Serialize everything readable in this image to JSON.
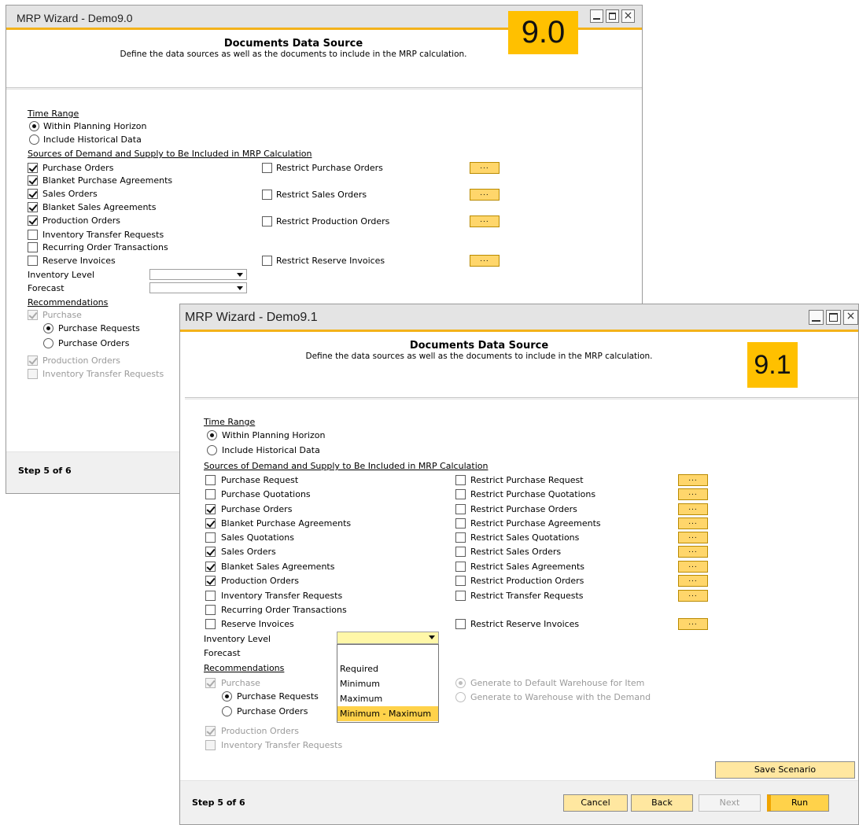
{
  "win90": {
    "title": "MRP Wizard - Demo9.0",
    "version": "9.0",
    "header_title": "Documents Data Source",
    "header_sub": "Define the data sources as well as the documents to include in the MRP calculation.",
    "time_range_label": "Time Range",
    "radio_within": "Within Planning Horizon",
    "radio_hist": "Include Historical Data",
    "sources_label": "Sources of Demand and Supply to Be Included in MRP Calculation",
    "sources": [
      {
        "label": "Purchase Orders",
        "checked": true
      },
      {
        "label": "Blanket Purchase Agreements",
        "checked": true
      },
      {
        "label": "Sales Orders",
        "checked": true
      },
      {
        "label": "Blanket Sales Agreements",
        "checked": true
      },
      {
        "label": "Production Orders",
        "checked": true
      },
      {
        "label": "Inventory Transfer Requests",
        "checked": false
      },
      {
        "label": "Recurring Order Transactions",
        "checked": false
      },
      {
        "label": "Reserve Invoices",
        "checked": false
      }
    ],
    "restricts": [
      "Restrict Purchase Orders",
      "Restrict Sales Orders",
      "Restrict Production Orders",
      "Restrict Reserve Invoices"
    ],
    "ellipsis": "...",
    "inventory_level": "Inventory Level",
    "forecast": "Forecast",
    "recommendations": "Recommendations",
    "purchase": "Purchase",
    "purchase_requests": "Purchase Requests",
    "purchase_orders": "Purchase Orders",
    "production_orders": "Production Orders",
    "inventory_transfer_requests": "Inventory Transfer Requests",
    "step": "Step 5 of 6"
  },
  "win91": {
    "title": "MRP Wizard - Demo9.1",
    "version": "9.1",
    "header_title": "Documents Data Source",
    "header_sub": "Define the data sources as well as the documents to include in the MRP calculation.",
    "time_range_label": "Time Range",
    "radio_within": "Within Planning Horizon",
    "radio_hist": "Include Historical Data",
    "sources_label": "Sources of Demand and Supply to Be Included in MRP Calculation",
    "sources": [
      {
        "label": "Purchase Request",
        "checked": false
      },
      {
        "label": "Purchase Quotations",
        "checked": false
      },
      {
        "label": "Purchase Orders",
        "checked": true
      },
      {
        "label": "Blanket Purchase Agreements",
        "checked": true
      },
      {
        "label": "Sales Quotations",
        "checked": false
      },
      {
        "label": "Sales Orders",
        "checked": true
      },
      {
        "label": "Blanket Sales Agreements",
        "checked": true
      },
      {
        "label": "Production Orders",
        "checked": true
      },
      {
        "label": "Inventory Transfer Requests",
        "checked": false
      },
      {
        "label": "Recurring Order Transactions",
        "checked": false
      },
      {
        "label": "Reserve Invoices",
        "checked": false
      }
    ],
    "restricts": [
      "Restrict Purchase Request",
      "Restrict Purchase Quotations",
      "Restrict Purchase Orders",
      "Restrict Purchase Agreements",
      "Restrict Sales Quotations",
      "Restrict Sales Orders",
      "Restrict Sales Agreements",
      "Restrict Production Orders",
      "Restrict Transfer Requests",
      "Restrict Reserve Invoices"
    ],
    "ellipsis": "...",
    "inventory_level": "Inventory Level",
    "forecast": "Forecast",
    "dropdown_options": [
      "Required",
      "Minimum",
      "Maximum",
      "Minimum - Maximum"
    ],
    "dropdown_selected": "Minimum - Maximum",
    "recommendations": "Recommendations",
    "purchase": "Purchase",
    "purchase_requests": "Purchase Requests",
    "purchase_orders": "Purchase Orders",
    "gen_default": "Generate to Default Warehouse for Item",
    "gen_demand": "Generate to Warehouse with the Demand",
    "production_orders": "Production Orders",
    "inventory_transfer_requests": "Inventory Transfer Requests",
    "save_scenario": "Save Scenario",
    "step": "Step 5 of 6",
    "cancel": "Cancel",
    "back": "Back",
    "next": "Next",
    "run": "Run"
  },
  "colors": {
    "accent": "#f3b21a",
    "version_badge": "#ffc000",
    "button": "#ffe7a0"
  }
}
